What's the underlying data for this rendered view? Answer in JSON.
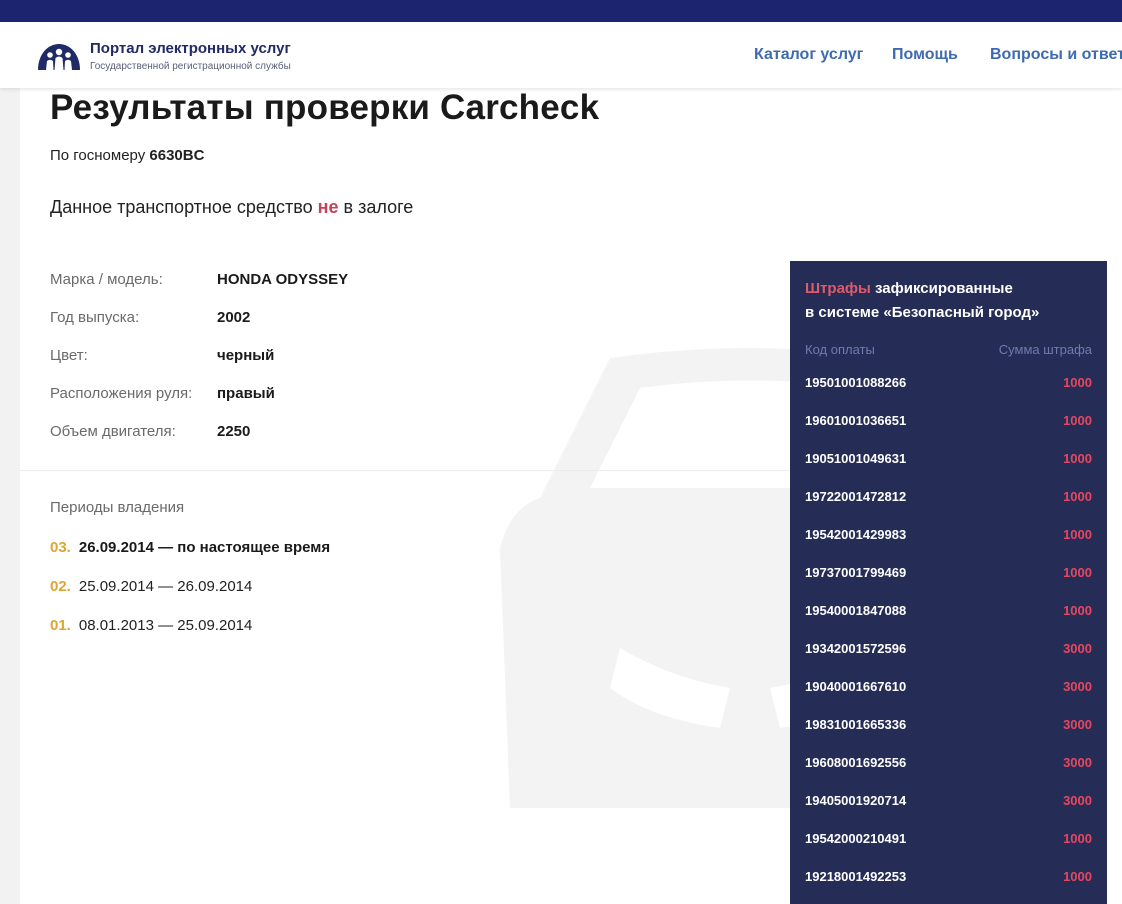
{
  "header": {
    "brand_title": "Портал электронных услуг",
    "brand_subtitle": "Государственной регистрационной службы",
    "nav": [
      "Каталог услуг",
      "Помощь",
      "Вопросы и ответы"
    ]
  },
  "main": {
    "title": "Результаты проверки Carcheck",
    "plate_prefix": "По госномеру ",
    "plate_number": "6630BC",
    "pledge_before": "Данное транспортное средство ",
    "pledge_neg": "не",
    "pledge_after": " в залоге",
    "specs": [
      {
        "label": "Марка / модель:",
        "value": "HONDA ODYSSEY"
      },
      {
        "label": "Год выпуска:",
        "value": "2002"
      },
      {
        "label": "Цвет:",
        "value": "черный"
      },
      {
        "label": "Расположения руля:",
        "value": "правый"
      },
      {
        "label": "Объем двигателя:",
        "value": "2250"
      }
    ],
    "periods_title": "Периоды владения",
    "periods": [
      {
        "num": "03.",
        "text": "26.09.2014 — по настоящее время"
      },
      {
        "num": "02.",
        "text": "25.09.2014 — 26.09.2014"
      },
      {
        "num": "01.",
        "text": "08.01.2013 — 25.09.2014"
      }
    ]
  },
  "fines": {
    "title_highlight": "Штрафы",
    "title_rest": " зафиксированные",
    "title_line2": "в системе «Безопасный город»",
    "col_code": "Код оплаты",
    "col_sum": "Сумма штрафа",
    "rows": [
      {
        "code": "19501001088266",
        "sum": "1000"
      },
      {
        "code": "19601001036651",
        "sum": "1000"
      },
      {
        "code": "19051001049631",
        "sum": "1000"
      },
      {
        "code": "19722001472812",
        "sum": "1000"
      },
      {
        "code": "19542001429983",
        "sum": "1000"
      },
      {
        "code": "19737001799469",
        "sum": "1000"
      },
      {
        "code": "19540001847088",
        "sum": "1000"
      },
      {
        "code": "19342001572596",
        "sum": "3000"
      },
      {
        "code": "19040001667610",
        "sum": "3000"
      },
      {
        "code": "19831001665336",
        "sum": "3000"
      },
      {
        "code": "19608001692556",
        "sum": "3000"
      },
      {
        "code": "19405001920714",
        "sum": "3000"
      },
      {
        "code": "19542000210491",
        "sum": "1000"
      },
      {
        "code": "19218001492253",
        "sum": "1000"
      }
    ]
  },
  "colors": {
    "topbar": "#1c2470",
    "nav_link": "#3e6bb0",
    "fines_panel": "#252d57",
    "fine_amount": "#e8465f",
    "period_number": "#e0a530",
    "pledge_negation": "#c2455a"
  },
  "icons": {
    "logo": "people-group-logo-icon",
    "watermark": "car-silhouette-icon"
  }
}
